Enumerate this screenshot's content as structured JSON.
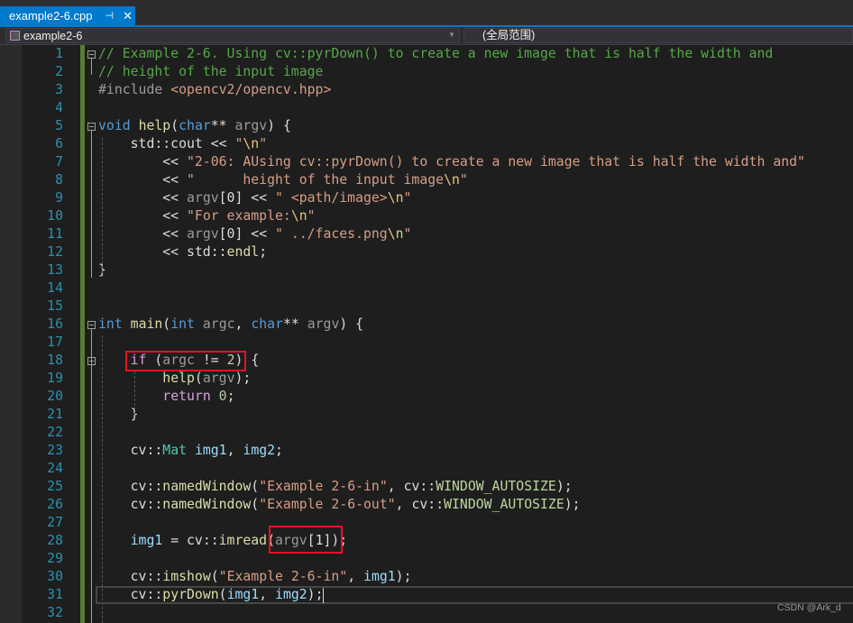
{
  "tab": {
    "title": "example2-6.cpp",
    "pin_icon": "pin-icon",
    "close_icon": "close-icon"
  },
  "navbar": {
    "project": "example2-6",
    "scope": "(全局范围)"
  },
  "colors": {
    "accent": "#007acc",
    "comment": "#57a64a",
    "keyword": "#569cd6",
    "string": "#d69d85",
    "highlight_box": "#e81123"
  },
  "lines": [
    {
      "n": "1",
      "t": [
        [
          "cm",
          "// Example 2-6. Using cv::pyrDown() to create a new image that is half the width and"
        ]
      ]
    },
    {
      "n": "2",
      "t": [
        [
          "cm",
          "// height of the input image"
        ]
      ]
    },
    {
      "n": "3",
      "t": [
        [
          "pre",
          "#include "
        ],
        [
          "str",
          "<opencv2/opencv.hpp>"
        ]
      ]
    },
    {
      "n": "4",
      "t": []
    },
    {
      "n": "5",
      "t": [
        [
          "kw",
          "void"
        ],
        [
          "pl",
          " "
        ],
        [
          "fn",
          "help"
        ],
        [
          "pl",
          "("
        ],
        [
          "kw",
          "char"
        ],
        [
          "pl",
          "** "
        ],
        [
          "prm",
          "argv"
        ],
        [
          "pl",
          ") {"
        ]
      ]
    },
    {
      "n": "6",
      "t": [
        [
          "pl",
          "    std::cout << "
        ],
        [
          "str",
          "\""
        ],
        [
          "esc",
          "\\n"
        ],
        [
          "str",
          "\""
        ]
      ]
    },
    {
      "n": "7",
      "t": [
        [
          "pl",
          "        << "
        ],
        [
          "str",
          "\"2-06: AUsing cv::pyrDown() to create a new image that is half the width and\""
        ]
      ]
    },
    {
      "n": "8",
      "t": [
        [
          "pl",
          "        << "
        ],
        [
          "str",
          "\"      height of the input image"
        ],
        [
          "esc",
          "\\n"
        ],
        [
          "str",
          "\""
        ]
      ]
    },
    {
      "n": "9",
      "t": [
        [
          "pl",
          "        << "
        ],
        [
          "prm",
          "argv"
        ],
        [
          "pl",
          "[0] << "
        ],
        [
          "str",
          "\" <path/image>"
        ],
        [
          "esc",
          "\\n"
        ],
        [
          "str",
          "\""
        ]
      ]
    },
    {
      "n": "10",
      "t": [
        [
          "pl",
          "        << "
        ],
        [
          "str",
          "\"For example:"
        ],
        [
          "esc",
          "\\n"
        ],
        [
          "str",
          "\""
        ]
      ]
    },
    {
      "n": "11",
      "t": [
        [
          "pl",
          "        << "
        ],
        [
          "prm",
          "argv"
        ],
        [
          "pl",
          "[0] << "
        ],
        [
          "str",
          "\" ../faces.png"
        ],
        [
          "esc",
          "\\n"
        ],
        [
          "str",
          "\""
        ]
      ]
    },
    {
      "n": "12",
      "t": [
        [
          "pl",
          "        << std::"
        ],
        [
          "fn",
          "endl"
        ],
        [
          "pl",
          ";"
        ]
      ]
    },
    {
      "n": "13",
      "t": [
        [
          "pl",
          "}"
        ]
      ]
    },
    {
      "n": "14",
      "t": []
    },
    {
      "n": "15",
      "t": []
    },
    {
      "n": "16",
      "t": [
        [
          "kw",
          "int"
        ],
        [
          "pl",
          " "
        ],
        [
          "fn",
          "main"
        ],
        [
          "pl",
          "("
        ],
        [
          "kw",
          "int"
        ],
        [
          "pl",
          " "
        ],
        [
          "prm",
          "argc"
        ],
        [
          "pl",
          ", "
        ],
        [
          "kw",
          "char"
        ],
        [
          "pl",
          "** "
        ],
        [
          "prm",
          "argv"
        ],
        [
          "pl",
          ") {"
        ]
      ]
    },
    {
      "n": "17",
      "t": []
    },
    {
      "n": "18",
      "t": [
        [
          "pl",
          "    "
        ],
        [
          "ctl",
          "if"
        ],
        [
          "pl",
          " ("
        ],
        [
          "prm",
          "argc"
        ],
        [
          "pl",
          " != "
        ],
        [
          "num",
          "2"
        ],
        [
          "pl",
          ") {"
        ]
      ]
    },
    {
      "n": "19",
      "t": [
        [
          "pl",
          "        "
        ],
        [
          "fn",
          "help"
        ],
        [
          "pl",
          "("
        ],
        [
          "prm",
          "argv"
        ],
        [
          "pl",
          ");"
        ]
      ]
    },
    {
      "n": "20",
      "t": [
        [
          "pl",
          "        "
        ],
        [
          "ctl",
          "return"
        ],
        [
          "pl",
          " "
        ],
        [
          "num",
          "0"
        ],
        [
          "pl",
          ";"
        ]
      ]
    },
    {
      "n": "21",
      "t": [
        [
          "pl",
          "    }"
        ]
      ]
    },
    {
      "n": "22",
      "t": []
    },
    {
      "n": "23",
      "t": [
        [
          "pl",
          "    cv::"
        ],
        [
          "ty",
          "Mat"
        ],
        [
          "pl",
          " "
        ],
        [
          "var",
          "img1"
        ],
        [
          "pl",
          ", "
        ],
        [
          "var",
          "img2"
        ],
        [
          "pl",
          ";"
        ]
      ]
    },
    {
      "n": "24",
      "t": []
    },
    {
      "n": "25",
      "t": [
        [
          "pl",
          "    cv::"
        ],
        [
          "fn",
          "namedWindow"
        ],
        [
          "pl",
          "("
        ],
        [
          "str",
          "\"Example 2-6-in\""
        ],
        [
          "pl",
          ", cv::"
        ],
        [
          "mac",
          "WINDOW_AUTOSIZE"
        ],
        [
          "pl",
          ");"
        ]
      ]
    },
    {
      "n": "26",
      "t": [
        [
          "pl",
          "    cv::"
        ],
        [
          "fn",
          "namedWindow"
        ],
        [
          "pl",
          "("
        ],
        [
          "str",
          "\"Example 2-6-out\""
        ],
        [
          "pl",
          ", cv::"
        ],
        [
          "mac",
          "WINDOW_AUTOSIZE"
        ],
        [
          "pl",
          ");"
        ]
      ]
    },
    {
      "n": "27",
      "t": []
    },
    {
      "n": "28",
      "t": [
        [
          "pl",
          "    "
        ],
        [
          "var",
          "img1"
        ],
        [
          "pl",
          " = cv::"
        ],
        [
          "fn",
          "imread"
        ],
        [
          "pl",
          "("
        ],
        [
          "prm",
          "argv"
        ],
        [
          "pl",
          "[1]);"
        ]
      ]
    },
    {
      "n": "29",
      "t": []
    },
    {
      "n": "30",
      "t": [
        [
          "pl",
          "    cv::"
        ],
        [
          "fn",
          "imshow"
        ],
        [
          "pl",
          "("
        ],
        [
          "str",
          "\"Example 2-6-in\""
        ],
        [
          "pl",
          ", "
        ],
        [
          "var",
          "img1"
        ],
        [
          "pl",
          ");"
        ]
      ]
    },
    {
      "n": "31",
      "t": [
        [
          "pl",
          "    cv::"
        ],
        [
          "fn",
          "pyrDown"
        ],
        [
          "pl",
          "("
        ],
        [
          "var",
          "img1"
        ],
        [
          "pl",
          ", "
        ],
        [
          "var",
          "img2"
        ],
        [
          "pl",
          ");"
        ]
      ]
    },
    {
      "n": "32",
      "t": []
    }
  ],
  "watermark": "CSDN @Ark_d"
}
